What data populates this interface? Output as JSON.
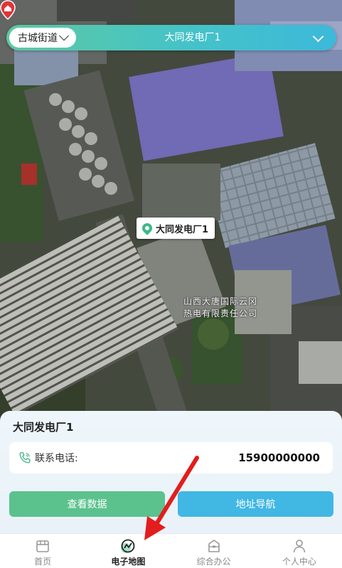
{
  "header": {
    "street_selector": "古城街道",
    "plant_selector": "大同发电厂1"
  },
  "map": {
    "marker_label": "大同发电厂1",
    "poi_label_line1": "山西大唐国际云冈",
    "poi_label_line2": "热电有限责任公司"
  },
  "panel": {
    "title": "大同发电厂1",
    "phone_label": "联系电话:",
    "phone_value": "15900000000",
    "view_data_button": "查看数据",
    "navigate_button": "地址导航"
  },
  "tabbar": {
    "items": [
      {
        "label": "首页",
        "icon": "home-icon",
        "active": false
      },
      {
        "label": "电子地图",
        "icon": "map-icon",
        "active": true
      },
      {
        "label": "综合办公",
        "icon": "office-icon",
        "active": false
      },
      {
        "label": "个人中心",
        "icon": "user-icon",
        "active": false
      }
    ]
  },
  "colors": {
    "accent_green": "#5bc28e",
    "accent_blue": "#41b7e4",
    "topbar_gradient_start": "#5cc9a0",
    "topbar_gradient_end": "#3cb9da",
    "marker_red": "#e0343a"
  }
}
